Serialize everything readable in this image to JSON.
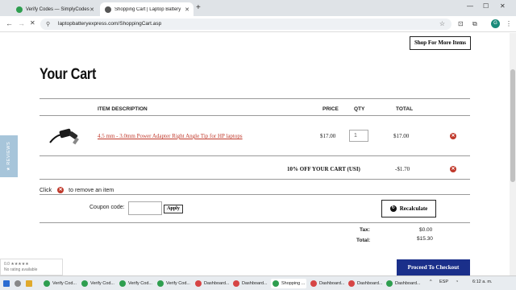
{
  "browser": {
    "tabs": [
      {
        "title": "Verify Codes — SimplyCodes",
        "active": false
      },
      {
        "title": "Shopping Cart | Laptop Battery",
        "active": true
      }
    ],
    "url": "laptopbatteryexpress.com/ShoppingCart.asp",
    "profile_initial": "G"
  },
  "page": {
    "shop_more_label": "Shop For More Items",
    "title": "Your Cart",
    "columns": {
      "description": "ITEM DESCRIPTION",
      "price": "PRICE",
      "qty": "QTY",
      "total": "TOTAL"
    },
    "items": [
      {
        "description": "4.5 mm - 3.0mm Power Adapter Right Angle Tip for HP laptops",
        "price": "$17.00",
        "qty": "1",
        "total": "$17.00"
      }
    ],
    "discount": {
      "label": "10% OFF YOUR CART (USI)",
      "value": "-$1.70"
    },
    "remove_hint": {
      "before": "Click",
      "after": "to remove an item"
    },
    "coupon": {
      "label": "Coupon code:",
      "value": "",
      "apply_label": "Apply"
    },
    "recalculate_label": "Recalculate",
    "summary": {
      "tax_label": "Tax:",
      "tax_value": "$0.00",
      "total_label": "Total:",
      "total_value": "$15.30"
    },
    "checkout_label": "Proceed To Checkout",
    "reviews_tab": "★ REVIEWS",
    "rating_widget": {
      "stars": "0.0 ★★★★★",
      "text": "No rating available"
    }
  },
  "taskbar": {
    "items": [
      "Verify Cod...",
      "Verify Cod...",
      "Verify Cod...",
      "Verify Cod...",
      "Dashboard...",
      "Dashboard...",
      "Shopping ...",
      "Dashboard...",
      "Dashboard...",
      "Dashboard..."
    ],
    "lang": "ESP",
    "clock": "6:12 a. m."
  },
  "colors": {
    "accent_link": "#c0392b",
    "checkout": "#1a2f8a",
    "reviews_tab": "#a7c5da"
  }
}
